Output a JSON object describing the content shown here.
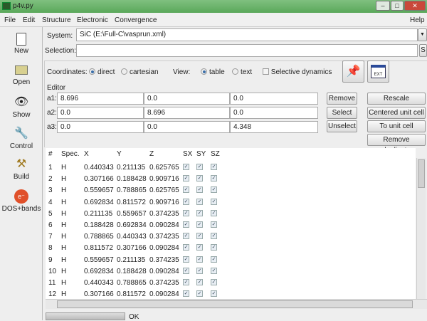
{
  "window": {
    "title": "p4v.py"
  },
  "menu": [
    "File",
    "Edit",
    "Structure",
    "Electronic",
    "Convergence"
  ],
  "menu_help": "Help",
  "toolbar": [
    {
      "label": "New",
      "icon": "new-file-icon"
    },
    {
      "label": "Open",
      "icon": "folder-icon"
    },
    {
      "label": "Show",
      "icon": "eye-icon"
    },
    {
      "label": "Control",
      "icon": "wrench-icon"
    },
    {
      "label": "Build",
      "icon": "crane-icon"
    },
    {
      "label": "DOS+bands",
      "icon": "electron-icon"
    }
  ],
  "system": {
    "label": "System:",
    "value": "SiC (E:\\Full-C\\vasprun.xml)"
  },
  "selection": {
    "label": "Selection:",
    "value": "",
    "button": "S"
  },
  "coords": {
    "label": "Coordinates:",
    "direct": "direct",
    "cartesian": "cartesian",
    "selected": "direct"
  },
  "view": {
    "label": "View:",
    "table": "table",
    "text": "text",
    "selected": "table"
  },
  "selective_dynamics": {
    "label": "Selective dynamics",
    "checked": false
  },
  "editor": {
    "label": "Editor",
    "rows": [
      {
        "label": "a1:",
        "values": [
          "8.696",
          "0.0",
          "0.0"
        ]
      },
      {
        "label": "a2:",
        "values": [
          "0.0",
          "8.696",
          "0.0"
        ]
      },
      {
        "label": "a3:",
        "values": [
          "0.0",
          "0.0",
          "4.348"
        ]
      }
    ]
  },
  "buttons": {
    "remove": "Remove",
    "select": "Select",
    "unselect": "Unselect",
    "rescale": "Rescale",
    "centered": "Centered unit cell",
    "to_unit": "To unit cell",
    "remove_dup": "Remove duplicate"
  },
  "table": {
    "headers": [
      "#",
      "Spec.",
      "X",
      "Y",
      "Z",
      "SX",
      "SY",
      "SZ"
    ],
    "rows": [
      [
        "1",
        "H",
        "0.440343",
        "0.211135",
        "0.625765"
      ],
      [
        "2",
        "H",
        "0.307166",
        "0.188428",
        "0.909716"
      ],
      [
        "3",
        "H",
        "0.559657",
        "0.788865",
        "0.625765"
      ],
      [
        "4",
        "H",
        "0.692834",
        "0.811572",
        "0.909716"
      ],
      [
        "5",
        "H",
        "0.211135",
        "0.559657",
        "0.374235"
      ],
      [
        "6",
        "H",
        "0.188428",
        "0.692834",
        "0.090284"
      ],
      [
        "7",
        "H",
        "0.788865",
        "0.440343",
        "0.374235"
      ],
      [
        "8",
        "H",
        "0.811572",
        "0.307166",
        "0.090284"
      ],
      [
        "9",
        "H",
        "0.559657",
        "0.211135",
        "0.374235"
      ],
      [
        "10",
        "H",
        "0.692834",
        "0.188428",
        "0.090284"
      ],
      [
        "11",
        "H",
        "0.440343",
        "0.788865",
        "0.374235"
      ],
      [
        "12",
        "H",
        "0.307166",
        "0.811572",
        "0.090284"
      ]
    ]
  },
  "status": {
    "text": "OK"
  }
}
